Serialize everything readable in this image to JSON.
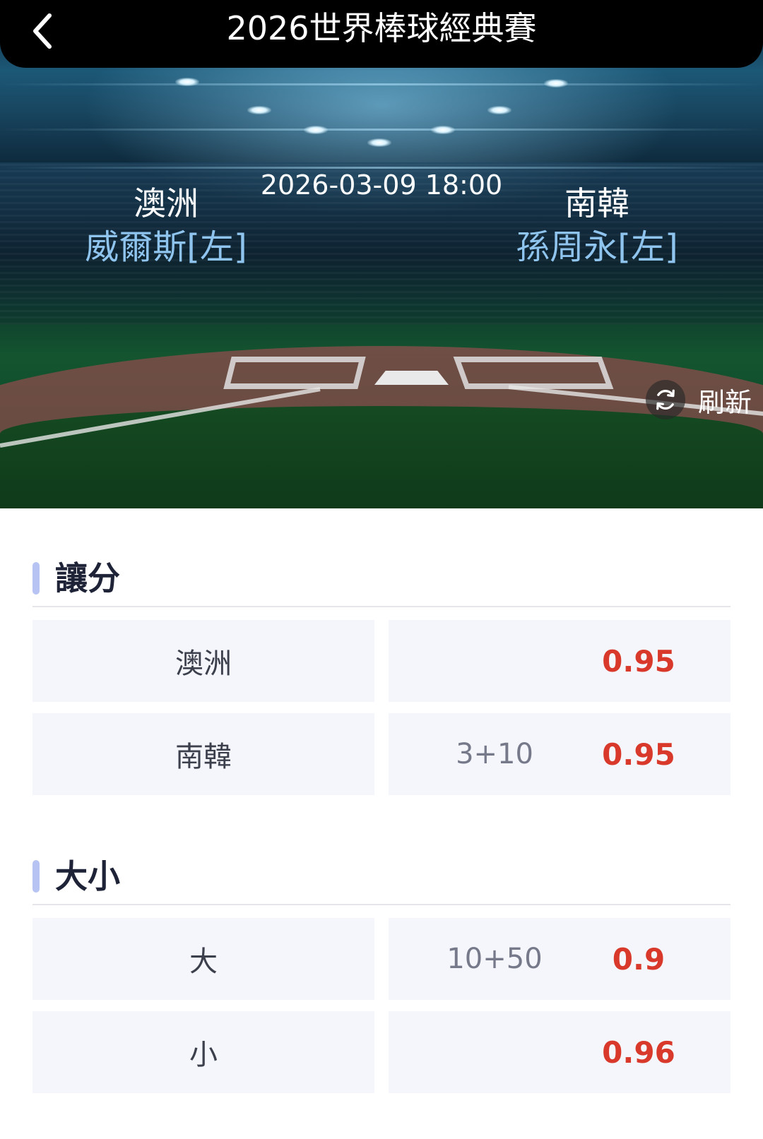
{
  "header": {
    "title": "2026世界棒球經典賽",
    "back_icon": "chevron-left-icon"
  },
  "match": {
    "datetime": "2026-03-09 18:00",
    "home": {
      "team": "澳洲",
      "pitcher": "威爾斯[左]"
    },
    "away": {
      "team": "南韓",
      "pitcher": "孫周永[左]"
    },
    "refresh_label": "刷新",
    "refresh_icon": "refresh-icon"
  },
  "sections": [
    {
      "title": "讓分",
      "rows": [
        {
          "label": "澳洲",
          "line": "",
          "odds": "0.95"
        },
        {
          "label": "南韓",
          "line": "3+10",
          "odds": "0.95"
        }
      ]
    },
    {
      "title": "大小",
      "rows": [
        {
          "label": "大",
          "line": "10+50",
          "odds": "0.9"
        },
        {
          "label": "小",
          "line": "",
          "odds": "0.96"
        }
      ]
    }
  ],
  "colors": {
    "odds": "#d8392b",
    "accent": "#b7c4f3",
    "cell_bg": "#f5f6fb",
    "pitcher_text": "#8fc4ef"
  }
}
